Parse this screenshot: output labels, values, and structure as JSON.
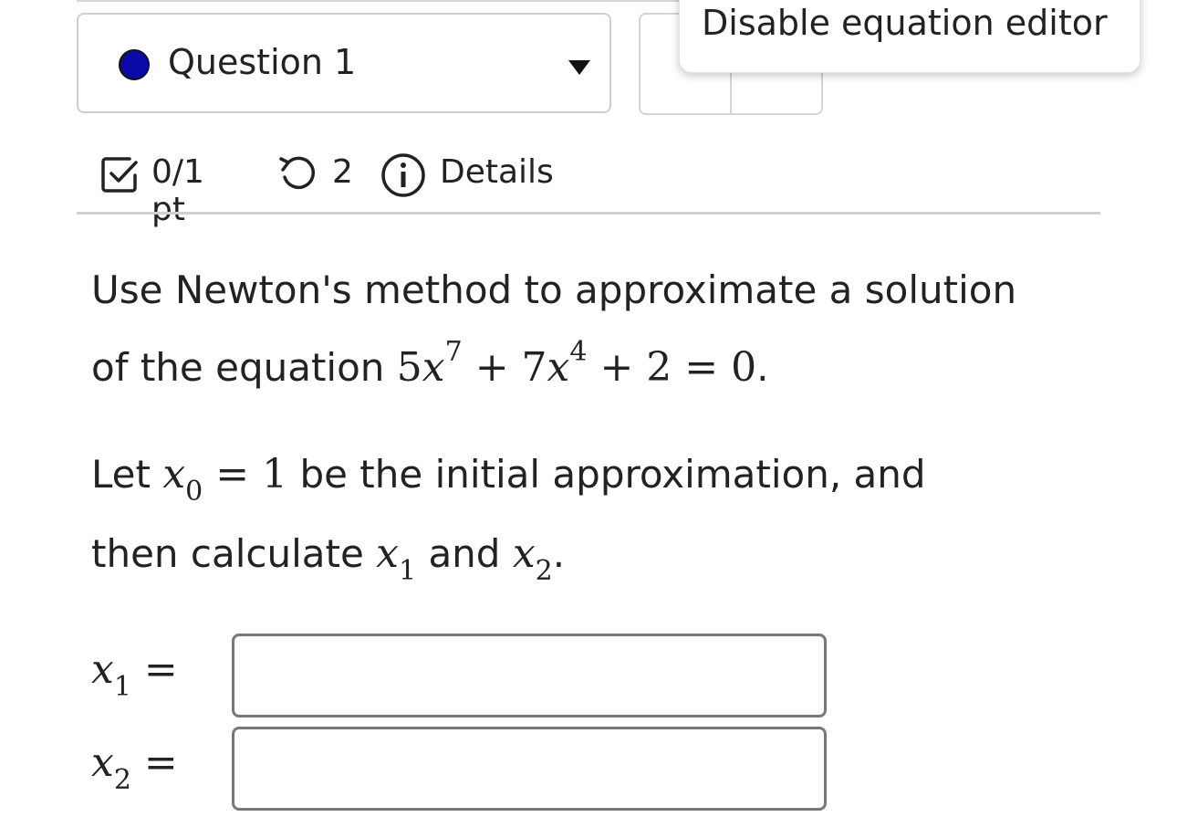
{
  "header": {
    "question_label": "Question 1",
    "question_status_color": "#0a0aa8",
    "tooltip": "Disable equation editor"
  },
  "meta": {
    "points": "0/1 pt",
    "tries": "2",
    "details": "Details",
    "icons": [
      "checkbox-icon",
      "retry-icon",
      "info-icon"
    ]
  },
  "problem": {
    "line1_text": "Use Newton's method to approximate a solution",
    "line2_prefix": "of the equation ",
    "eq_5": "5",
    "eq_x": "x",
    "eq_exp7": "7",
    "eq_plus7": " + 7",
    "eq_exp4": "4",
    "eq_rest": " + 2 = 0",
    "eq_period": ".",
    "line3_prefix": "Let ",
    "x0_sub": "0",
    "x0_eq": " = 1",
    "line3_suffix": " be the initial approximation, and",
    "line4_prefix": "then calculate ",
    "x1_sub": "1",
    "line4_and": " and ",
    "x2_sub": "2",
    "line4_period": "."
  },
  "answers": [
    {
      "var": "x",
      "sub": "1",
      "eq": " =",
      "value": ""
    },
    {
      "var": "x",
      "sub": "2",
      "eq": " =",
      "value": ""
    }
  ]
}
